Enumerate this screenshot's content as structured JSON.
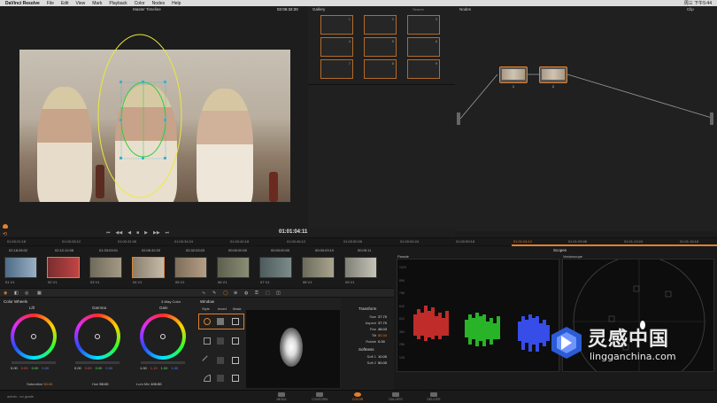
{
  "menubar": {
    "app_name": "DaVinci Resolve",
    "items": [
      "File",
      "Edit",
      "View",
      "Mark",
      "Playback",
      "Color",
      "Nodes",
      "Help"
    ],
    "status_right": "周三 下午5:44"
  },
  "viewer": {
    "title": "Master Timeline",
    "timecode_top": "02:06:32:20",
    "timecode": "01:01:04:11"
  },
  "gallery": {
    "title": "Gallery",
    "search": "Search",
    "stills": [
      "1",
      "2",
      "3",
      "4",
      "5",
      "6",
      "7",
      "8",
      "9"
    ]
  },
  "nodes": {
    "title": "Nodes",
    "clip_label": "Clip",
    "node1": "1",
    "node2": "2"
  },
  "ruler": [
    "01:00:21:18",
    "01:00:28:12",
    "01:00:31:06",
    "01:00:34:24",
    "01:00:40:18",
    "01:00:46:12",
    "01:00:50:06",
    "01:00:54:24",
    "01:00:59:18",
    "01:01:04:12",
    "01:01:09:06",
    "01:01:13:24",
    "01:01:18:18"
  ],
  "clips": [
    {
      "tc": "02:18:28:02",
      "label": "01 V1"
    },
    {
      "tc": "02:12:12:08",
      "label": "02 V1"
    },
    {
      "tc": "01:33:03:01",
      "label": "03 V1"
    },
    {
      "tc": "02:06:32:20",
      "label": "04 V1"
    },
    {
      "tc": "02:32:03:03",
      "label": "05 V1"
    },
    {
      "tc": "00:00:00:00",
      "label": "06 V1"
    },
    {
      "tc": "00:00:00:00",
      "label": "07 V1"
    },
    {
      "tc": "00:00:03:10",
      "label": "08 V1"
    },
    {
      "tc": "00:05:11",
      "label": "09 V1"
    }
  ],
  "color_wheels": {
    "title": "Color Wheels",
    "mode": "3-Way Color",
    "lift": {
      "label": "Lift",
      "values": [
        "0.00",
        "0.00",
        "0.00",
        "0.00"
      ]
    },
    "gamma": {
      "label": "Gamma",
      "values": [
        "0.00",
        "0.00",
        "0.00",
        "0.00"
      ]
    },
    "gain": {
      "label": "Gain",
      "values": [
        "1.00",
        "1.13",
        "1.00",
        "1.00"
      ]
    },
    "saturation_label": "Saturation",
    "saturation": "50.00",
    "hue_label": "Hue",
    "hue": "50.00",
    "lummix_label": "Lum Mix",
    "lummix": "100.00"
  },
  "window": {
    "title": "Window",
    "tabs": [
      "Style",
      "Invert",
      "Mask"
    ]
  },
  "transform": {
    "title": "Transform",
    "rows": [
      {
        "k": "Size",
        "v": "37.70"
      },
      {
        "k": "Aspect",
        "v": "37.70"
      },
      {
        "k": "Pan",
        "v": "48.03"
      },
      {
        "k": "Tilt",
        "v": "50.34"
      },
      {
        "k": "Rotate",
        "v": "0.00"
      }
    ],
    "softness_title": "Softness",
    "soft_rows": [
      {
        "k": "Soft 1",
        "v": "10.00"
      },
      {
        "k": "Soft 2",
        "v": "50.00"
      }
    ]
  },
  "scopes": {
    "title": "Scopes",
    "parade_label": "Parade",
    "vscope_label": "Vectorscope",
    "scale": [
      "1023",
      "896",
      "768",
      "640",
      "512",
      "384",
      "256",
      "128",
      "0"
    ]
  },
  "pages": [
    "MEDIA",
    "CONFORM",
    "COLOR",
    "GALLERY",
    "DELIVER"
  ],
  "active_page": "COLOR",
  "user": "admin : on grade",
  "watermark": {
    "title": "灵感中国",
    "url": "lingganchina.com"
  },
  "colors": {
    "accent": "#e0812f",
    "selection": "#eaea3a",
    "tracker": "#2bd13a"
  }
}
